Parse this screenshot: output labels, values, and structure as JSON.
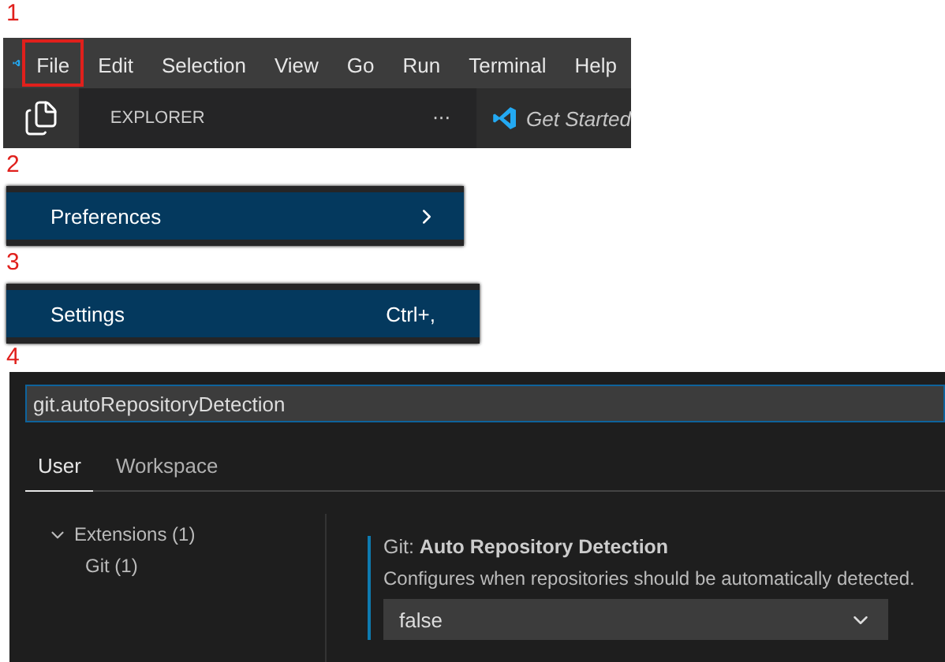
{
  "step1": {
    "number": "1",
    "menu": [
      {
        "label": "File",
        "selected": true
      },
      {
        "label": "Edit",
        "selected": false
      },
      {
        "label": "Selection",
        "selected": false
      },
      {
        "label": "View",
        "selected": false
      },
      {
        "label": "Go",
        "selected": false
      },
      {
        "label": "Run",
        "selected": false
      },
      {
        "label": "Terminal",
        "selected": false
      },
      {
        "label": "Help",
        "selected": false
      }
    ],
    "explorer_title": "EXPLORER",
    "more": "···",
    "tab_title": "Get Started"
  },
  "step2": {
    "number": "2",
    "item": {
      "label": "Preferences"
    }
  },
  "step3": {
    "number": "3",
    "item": {
      "label": "Settings",
      "shortcut": "Ctrl+,"
    }
  },
  "step4": {
    "number": "4",
    "search": {
      "value": "git.autoRepositoryDetection"
    },
    "tabs": [
      {
        "label": "User",
        "selected": true
      },
      {
        "label": "Workspace",
        "selected": false
      }
    ],
    "tree": [
      {
        "label": "Extensions (1)",
        "expanded": true,
        "children": [
          {
            "label": "Git (1)"
          }
        ]
      }
    ],
    "setting": {
      "category": "Git: ",
      "title": "Auto Repository Detection",
      "description": "Configures when repositories should be automatically detected.",
      "value": "false"
    }
  }
}
